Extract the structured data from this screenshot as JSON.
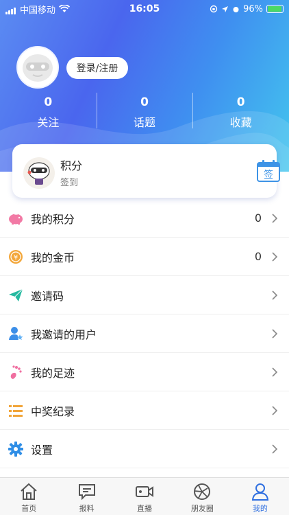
{
  "status_bar": {
    "carrier": "中国移动",
    "time": "16:05",
    "battery": "96%"
  },
  "profile": {
    "login_label": "登录/注册"
  },
  "stats": [
    {
      "value": "0",
      "label": "关注"
    },
    {
      "value": "0",
      "label": "话题"
    },
    {
      "value": "0",
      "label": "收藏"
    }
  ],
  "points_card": {
    "title": "积分",
    "subtitle": "签到",
    "calendar_text": "签"
  },
  "menu": [
    {
      "label": "我的积分",
      "value": "0",
      "icon": "piggy-bank-icon"
    },
    {
      "label": "我的金币",
      "value": "0",
      "icon": "coin-icon"
    },
    {
      "label": "邀请码",
      "value": "",
      "icon": "paper-plane-icon"
    },
    {
      "label": "我邀请的用户",
      "value": "",
      "icon": "user-star-icon"
    },
    {
      "label": "我的足迹",
      "value": "",
      "icon": "footprint-icon"
    },
    {
      "label": "中奖纪录",
      "value": "",
      "icon": "list-icon"
    },
    {
      "label": "设置",
      "value": "",
      "icon": "gear-icon"
    }
  ],
  "tabs": [
    {
      "label": "首页",
      "icon": "home-icon"
    },
    {
      "label": "报料",
      "icon": "message-icon"
    },
    {
      "label": "直播",
      "icon": "video-camera-icon"
    },
    {
      "label": "朋友圈",
      "icon": "aperture-icon"
    },
    {
      "label": "我的",
      "icon": "user-icon",
      "active": true
    }
  ],
  "colors": {
    "accent": "#2f6fe0",
    "gradient_start": "#5b8cf2",
    "gradient_end": "#43c6ee"
  }
}
